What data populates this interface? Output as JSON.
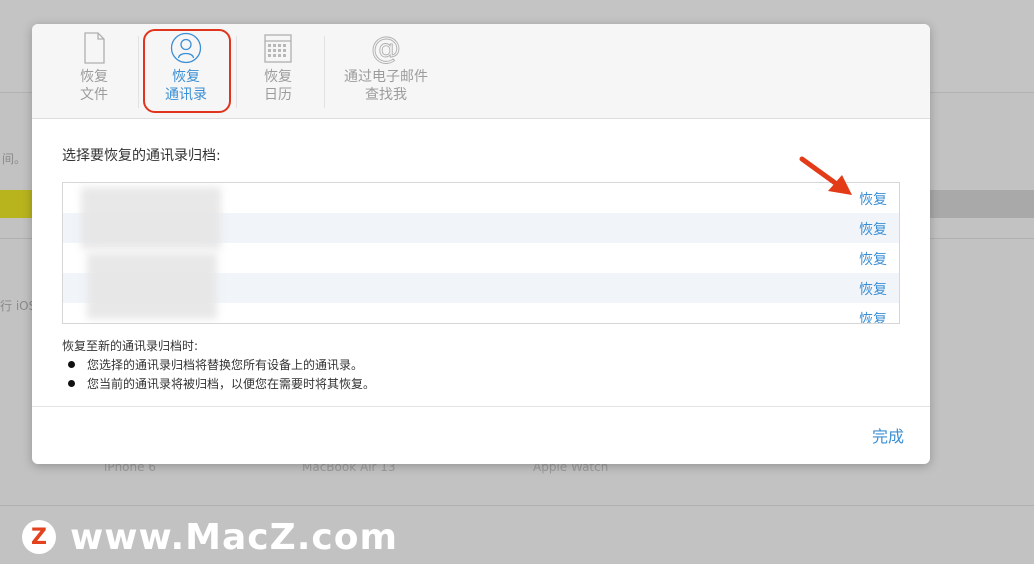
{
  "background": {
    "left_fragment_1": "间。",
    "left_fragment_2": "行 iOS",
    "devices": [
      "iPhone 6",
      "MacBook Air 13",
      "Apple Watch"
    ]
  },
  "toolbar": {
    "tabs": [
      {
        "line1": "恢复",
        "line2": "文件",
        "icon": "file-icon",
        "active": false
      },
      {
        "line1": "恢复",
        "line2": "通讯录",
        "icon": "contacts-icon",
        "active": true
      },
      {
        "line1": "恢复",
        "line2": "日历",
        "icon": "calendar-icon",
        "active": false
      },
      {
        "line1": "通过电子邮件",
        "line2": "查找我",
        "icon": "at-icon",
        "active": false
      }
    ]
  },
  "content": {
    "prompt": "选择要恢复的通讯录归档:",
    "restore_label": "恢复",
    "rows": 5,
    "note_title": "恢复至新的通讯录归档时:",
    "bullets": [
      "您选择的通讯录归档将替换您所有设备上的通讯录。",
      "您当前的通讯录将被归档，以便您在需要时将其恢复。"
    ]
  },
  "footer": {
    "done_label": "完成"
  },
  "colors": {
    "accent": "#3c8fd4",
    "highlight": "#e0341c"
  },
  "watermark": {
    "logo_letter": "Z",
    "text": "www.MacZ.com"
  }
}
